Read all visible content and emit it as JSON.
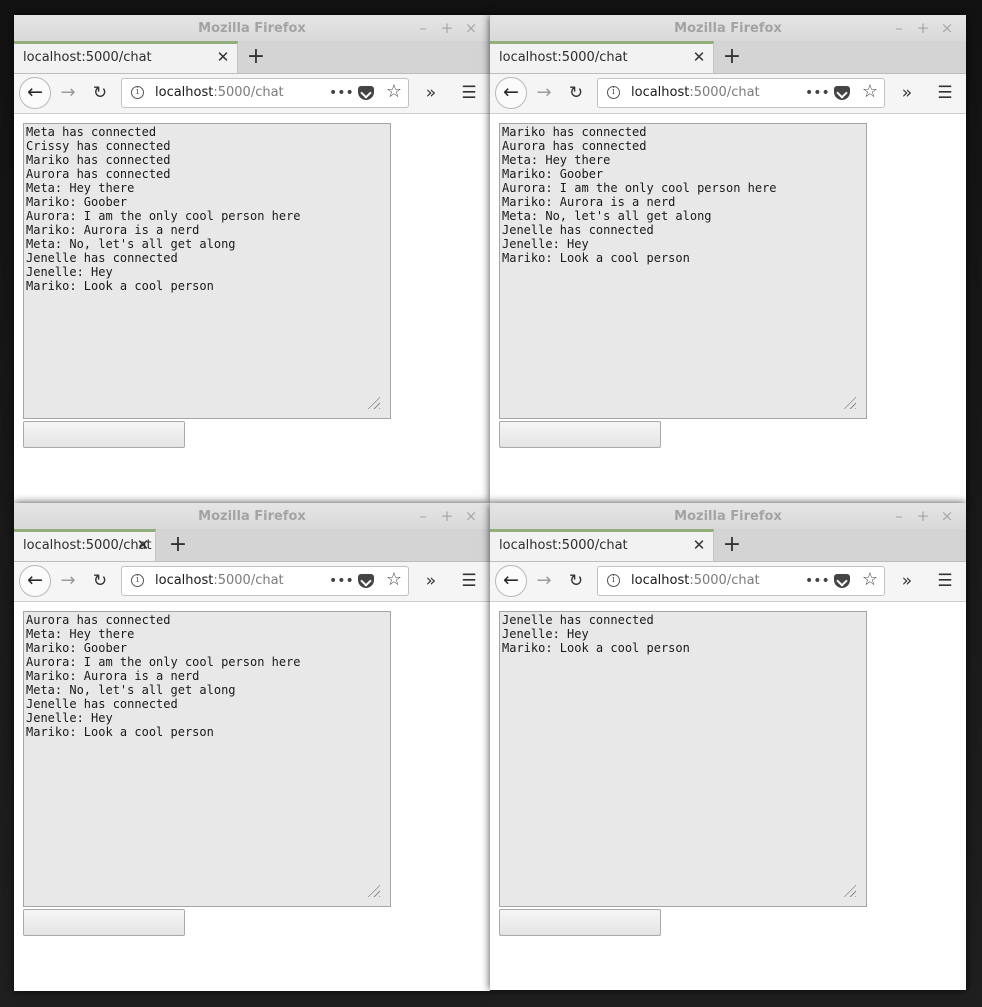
{
  "windows": [
    {
      "title": "Mozilla Firefox",
      "tab_title": "localhost:5000/chat",
      "url_host": "localhost",
      "url_path": ":5000/chat",
      "messages": [
        "Meta has connected",
        "Crissy has connected",
        "Mariko has connected",
        "Aurora has connected",
        "Meta: Hey there",
        "Mariko: Goober",
        "Aurora: I am the only cool person here",
        "Mariko: Aurora is a nerd",
        "Meta: No, let's all get along",
        "Jenelle has connected",
        "Jenelle: Hey",
        "Mariko: Look a cool person"
      ],
      "input_value": ""
    },
    {
      "title": "Mozilla Firefox",
      "tab_title": "localhost:5000/chat",
      "url_host": "localhost",
      "url_path": ":5000/chat",
      "messages": [
        "Mariko has connected",
        "Aurora has connected",
        "Meta: Hey there",
        "Mariko: Goober",
        "Aurora: I am the only cool person here",
        "Mariko: Aurora is a nerd",
        "Meta: No, let's all get along",
        "Jenelle has connected",
        "Jenelle: Hey",
        "Mariko: Look a cool person"
      ],
      "input_value": ""
    },
    {
      "title": "Mozilla Firefox",
      "tab_title": "localhost:5000/chat",
      "url_host": "localhost",
      "url_path": ":5000/chat",
      "messages": [
        "Aurora has connected",
        "Meta: Hey there",
        "Mariko: Goober",
        "Aurora: I am the only cool person here",
        "Mariko: Aurora is a nerd",
        "Meta: No, let's all get along",
        "Jenelle has connected",
        "Jenelle: Hey",
        "Mariko: Look a cool person"
      ],
      "input_value": ""
    },
    {
      "title": "Mozilla Firefox",
      "tab_title": "localhost:5000/chat",
      "url_host": "localhost",
      "url_path": ":5000/chat",
      "messages": [
        "Jenelle has connected",
        "Jenelle: Hey",
        "Mariko: Look a cool person"
      ],
      "input_value": ""
    }
  ],
  "icons": {
    "minimize": "minimize-icon",
    "maximize": "maximize-icon",
    "close": "close-icon",
    "tab_close": "tab-close-icon",
    "new_tab": "plus-icon",
    "back": "back-arrow-icon",
    "forward": "forward-arrow-icon",
    "reload": "reload-icon",
    "site_info": "info-icon",
    "page_actions": "more-horizontal-icon",
    "pocket": "pocket-icon",
    "bookmark": "star-icon",
    "overflow": "chevron-double-right-icon",
    "menu": "hamburger-menu-icon"
  },
  "colors": {
    "tab_accent": "#8fae7a",
    "textarea_bg": "#e8e8e8",
    "title_text": "#a3a3a3"
  }
}
